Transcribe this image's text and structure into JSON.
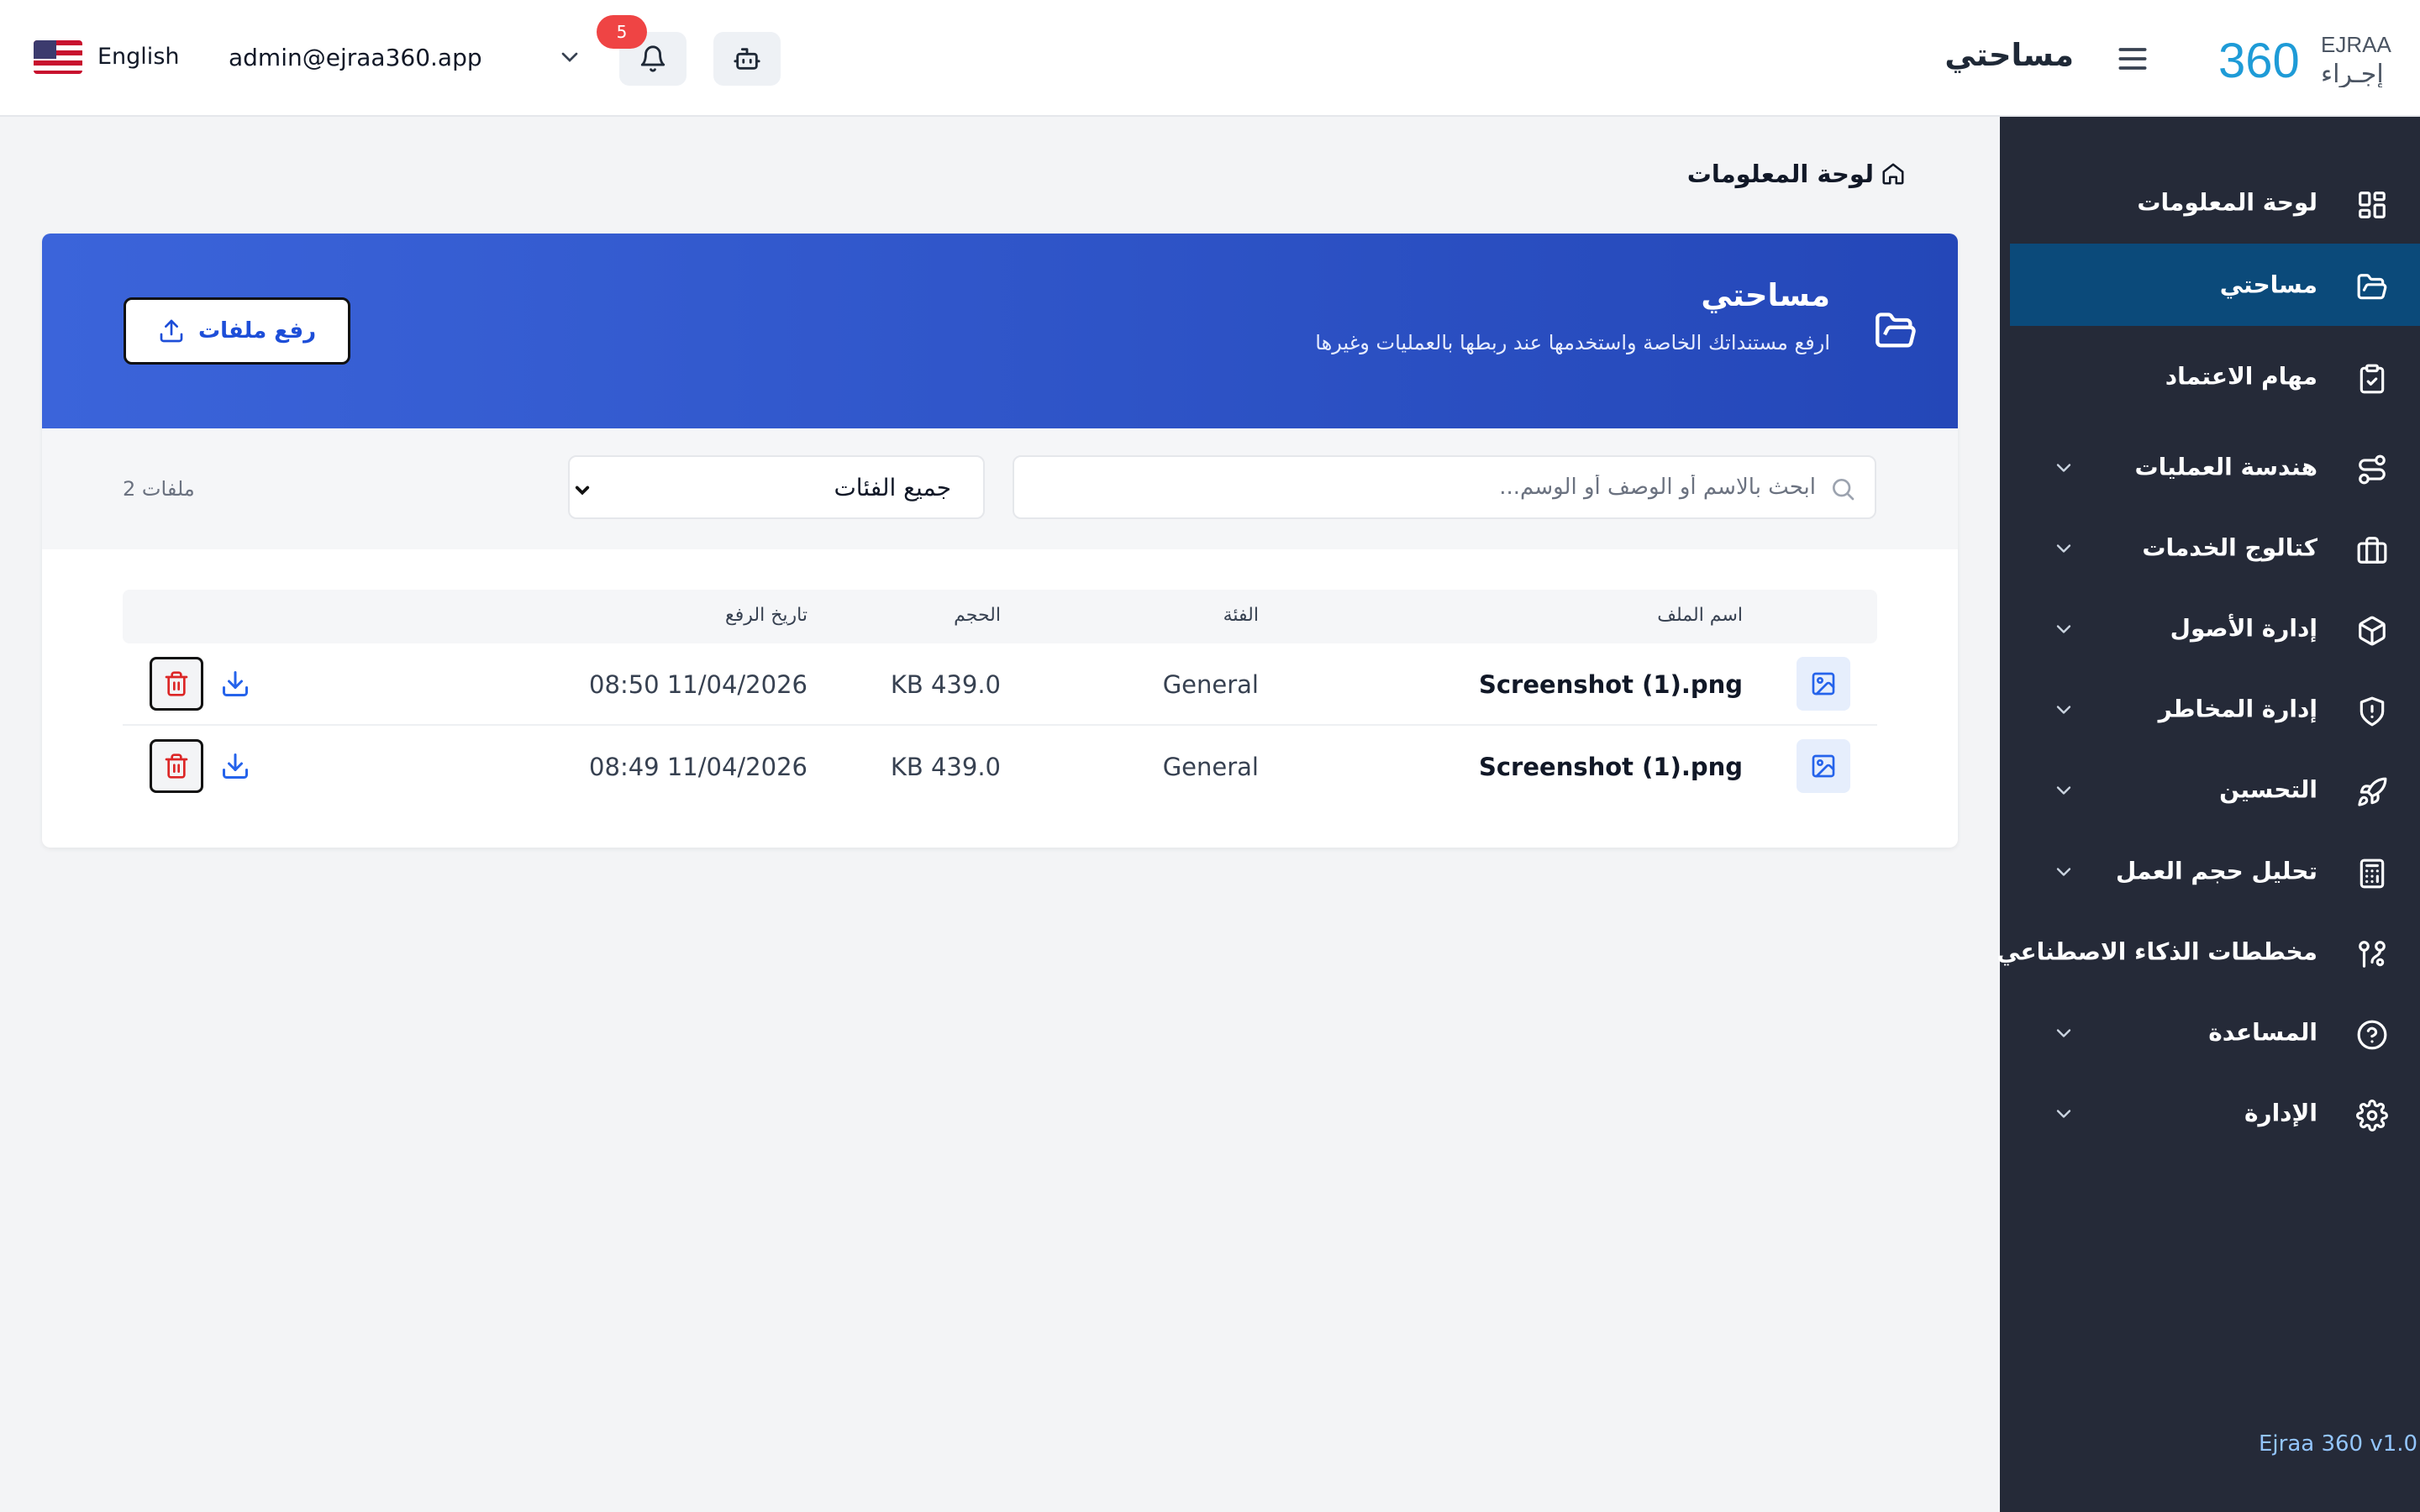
{
  "header": {
    "language": "English",
    "user_email": "admin@ejraa360.app",
    "notification_count": "5",
    "page_title": "مساحتي",
    "logo_text_en": "EJRAA",
    "logo_text_ar": "إجـراء",
    "logo_number": "360"
  },
  "sidebar": {
    "items": [
      {
        "label": "لوحة المعلومات",
        "icon": "dashboard-icon",
        "expandable": false,
        "active": false
      },
      {
        "label": "مساحتي",
        "icon": "folder-open-icon",
        "expandable": false,
        "active": true
      },
      {
        "label": "مهام الاعتماد",
        "icon": "clipboard-check-icon",
        "expandable": false,
        "active": false
      },
      {
        "label": "هندسة العمليات",
        "icon": "route-icon",
        "expandable": true,
        "active": false
      },
      {
        "label": "كتالوج الخدمات",
        "icon": "briefcase-icon",
        "expandable": true,
        "active": false
      },
      {
        "label": "إدارة الأصول",
        "icon": "cube-icon",
        "expandable": true,
        "active": false
      },
      {
        "label": "إدارة المخاطر",
        "icon": "shield-alert-icon",
        "expandable": true,
        "active": false
      },
      {
        "label": "التحسين",
        "icon": "rocket-icon",
        "expandable": true,
        "active": false
      },
      {
        "label": "تحليل حجم العمل",
        "icon": "calculator-icon",
        "expandable": true,
        "active": false
      },
      {
        "label": "مخططات الذكاء الاصطناعي",
        "icon": "workflow-icon",
        "expandable": false,
        "active": false
      },
      {
        "label": "المساعدة",
        "icon": "help-circle-icon",
        "expandable": true,
        "active": false
      },
      {
        "label": "الإدارة",
        "icon": "gear-icon",
        "expandable": true,
        "active": false
      }
    ],
    "version": "Ejraa 360 v1.0"
  },
  "breadcrumb": {
    "label": "لوحة المعلومات"
  },
  "banner": {
    "title": "مساحتي",
    "subtitle": "ارفع مستنداتك الخاصة واستخدمها عند ربطها بالعمليات وغيرها",
    "upload_label": "رفع ملفات"
  },
  "filters": {
    "search_placeholder": "ابحث بالاسم أو الوصف أو الوسم...",
    "category_value": "جميع الفئات",
    "file_count": "2 ملفات"
  },
  "table": {
    "columns": {
      "name": "اسم الملف",
      "category": "الفئة",
      "size": "الحجم",
      "date": "تاريخ الرفع"
    },
    "rows": [
      {
        "name": "Screenshot (1).png",
        "category": "General",
        "size": "KB 439.0",
        "date": "08:50 11/04/2026"
      },
      {
        "name": "Screenshot (1).png",
        "category": "General",
        "size": "KB 439.0",
        "date": "08:49 11/04/2026"
      }
    ]
  },
  "colors": {
    "brand_blue": "#2447b8",
    "sidebar_bg": "#252a38",
    "sidebar_active": "#0b4a7a",
    "badge_red": "#ef4444",
    "delete_red": "#dc2626"
  }
}
